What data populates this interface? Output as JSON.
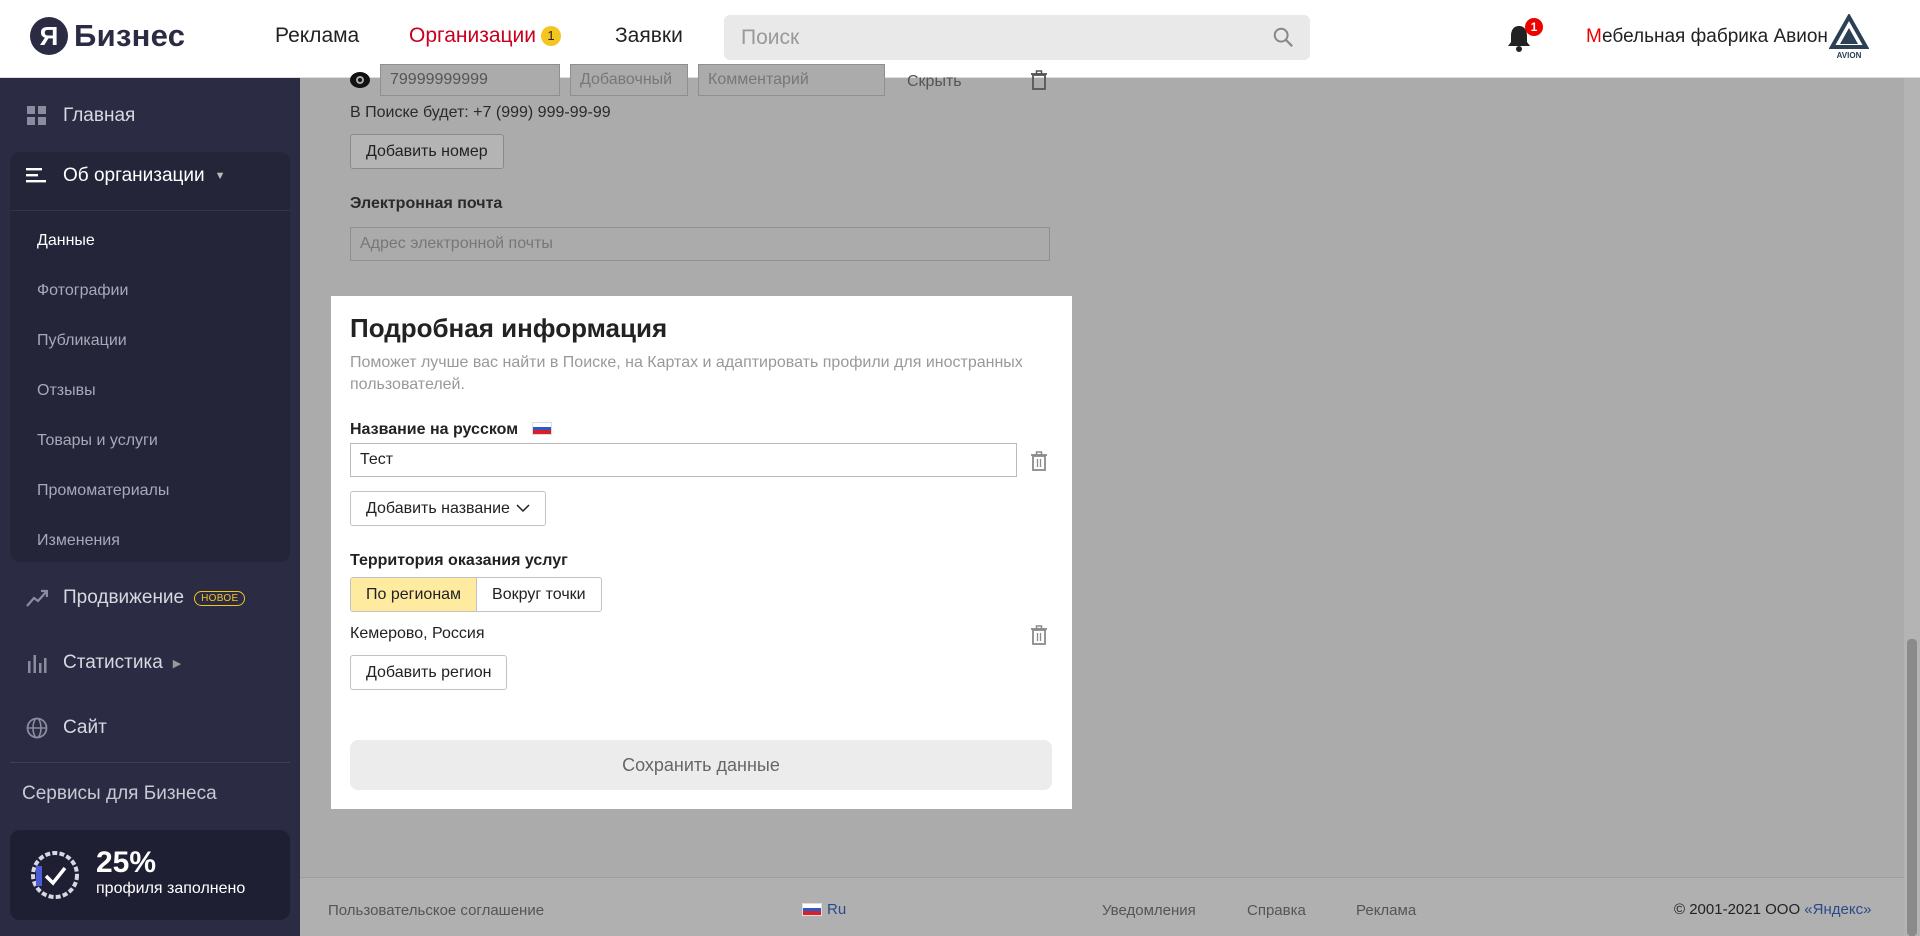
{
  "header": {
    "logo_mark": "Я",
    "logo_text": "Бизнес",
    "nav": {
      "reklama": "Реклама",
      "organizations": "Организации",
      "organizations_badge": "1",
      "requests": "Заявки"
    },
    "search_placeholder": "Поиск",
    "notifications_badge": "1",
    "company_first_letter": "М",
    "company_rest": "ебельная фабрика Авион",
    "avion_logo_text": "AVION"
  },
  "sidebar": {
    "home": "Главная",
    "about": "Об организации",
    "sub_items": [
      "Данные",
      "Фотографии",
      "Публикации",
      "Отзывы",
      "Товары и услуги",
      "Промоматериалы",
      "Изменения"
    ],
    "promotion": "Продвижение",
    "promotion_tag": "НОВОЕ",
    "statistics": "Статистика",
    "site": "Сайт",
    "services": "Сервисы для Бизнеса",
    "progress_value": "25%",
    "progress_fraction": 0.25,
    "progress_label": "профиля заполнено"
  },
  "background_form": {
    "phone_value": "79999999999",
    "extension_placeholder": "Добавочный",
    "comment_placeholder": "Комментарий",
    "hide_label": "Скрыть",
    "search_preview": "В Поиске будет: +7 (999) 999-99-99",
    "add_number": "Добавить номер",
    "email_label": "Электронная почта",
    "email_placeholder": "Адрес электронной почты"
  },
  "modal": {
    "title": "Подробная информация",
    "description": "Поможет лучше вас найти в Поиске, на Картах и адаптировать профили для иностранных пользователей.",
    "name_ru_label": "Название на русском",
    "name_ru_value": "Тест",
    "add_name": "Добавить название",
    "territory_label": "Территория оказания услуг",
    "territory_options": [
      "По регионам",
      "Вокруг точки"
    ],
    "region": "Кемерово, Россия",
    "add_region": "Добавить регион",
    "save": "Сохранить данные"
  },
  "footer": {
    "agreement": "Пользовательское соглашение",
    "lang": "Ru",
    "notifications": "Уведомления",
    "help": "Справка",
    "ads": "Реклама",
    "copyright_prefix": "© 2001-2021 ООО ",
    "copyright_link": "«Яндекс»"
  },
  "colors": {
    "sidebar_bg": "#2b2b44",
    "accent_red": "#c8001e",
    "badge_yellow": "#f4c521",
    "segment_active": "#ffeba0"
  }
}
